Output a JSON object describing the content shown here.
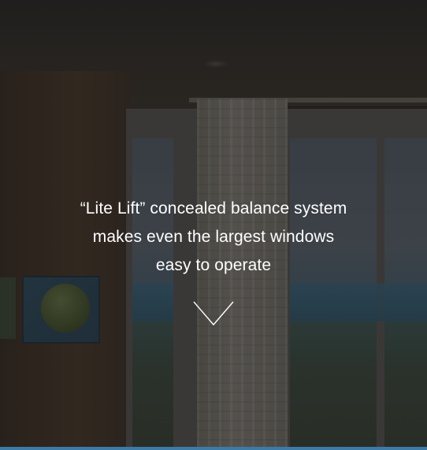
{
  "hero": {
    "headline_line1": "“Lite Lift” concealed balance system",
    "headline_line2": "makes even the largest windows",
    "headline_line3": "easy to operate",
    "overlay_color": "#141414",
    "accent_line_color": "#3e7aa6"
  },
  "icons": {
    "scroll_down": "chevron-down-icon"
  }
}
